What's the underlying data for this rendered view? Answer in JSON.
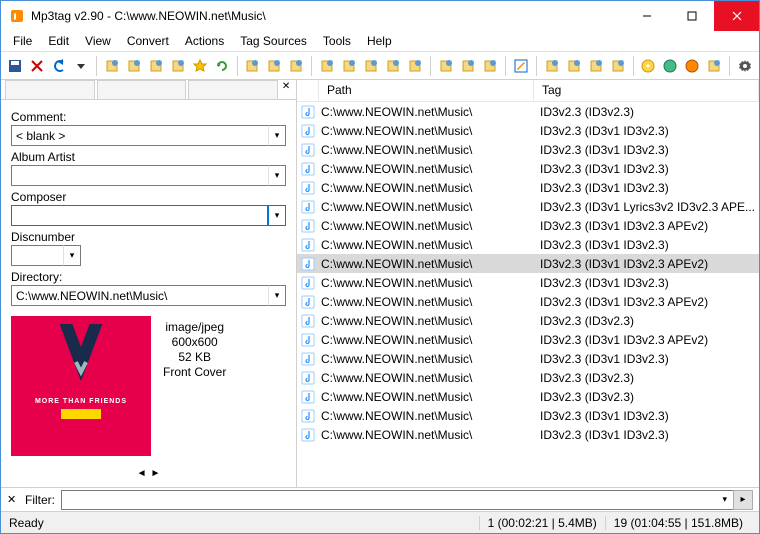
{
  "window": {
    "title": "Mp3tag v2.90  -  C:\\www.NEOWIN.net\\Music\\"
  },
  "menu": [
    "File",
    "Edit",
    "View",
    "Convert",
    "Actions",
    "Tag Sources",
    "Tools",
    "Help"
  ],
  "toolbar_icons": [
    "save-icon",
    "delete-icon",
    "undo-icon",
    "dropdown-icon",
    "open-folder-icon",
    "add-folder-icon",
    "save-playlist-icon",
    "save-all-icon",
    "favorites-icon",
    "refresh-icon",
    "list-icon",
    "list-numbered-icon",
    "highlight-icon",
    "tag-filename-icon",
    "filename-tag-icon",
    "tag-to-tag-icon",
    "text-to-tag-icon",
    "tag-to-text-icon",
    "actions-icon",
    "case-icon",
    "dropdown-small-icon",
    "edit-icon",
    "cut-tag-icon",
    "copy-tag-icon",
    "paste-tag-icon",
    "remove-tag-icon",
    "disc-icon",
    "web-icon",
    "cover-icon",
    "dropdown-small2-icon",
    "settings-icon"
  ],
  "panel": {
    "comment_label": "Comment:",
    "comment_value": "< blank >",
    "albumartist_label": "Album Artist",
    "albumartist_value": "",
    "composer_label": "Composer",
    "composer_value": "",
    "discnumber_label": "Discnumber",
    "discnumber_value": "",
    "directory_label": "Directory:",
    "directory_value": "C:\\www.NEOWIN.net\\Music\\",
    "cover": {
      "mime": "image/jpeg",
      "dims": "600x600",
      "size": "52 KB",
      "type": "Front Cover",
      "album_text": "MORE THAN FRIENDS"
    }
  },
  "columns": {
    "path": "Path",
    "tag": "Tag"
  },
  "rows": [
    {
      "path": "C:\\www.NEOWIN.net\\Music\\",
      "tag": "ID3v2.3 (ID3v2.3)"
    },
    {
      "path": "C:\\www.NEOWIN.net\\Music\\",
      "tag": "ID3v2.3 (ID3v1 ID3v2.3)"
    },
    {
      "path": "C:\\www.NEOWIN.net\\Music\\",
      "tag": "ID3v2.3 (ID3v1 ID3v2.3)"
    },
    {
      "path": "C:\\www.NEOWIN.net\\Music\\",
      "tag": "ID3v2.3 (ID3v1 ID3v2.3)"
    },
    {
      "path": "C:\\www.NEOWIN.net\\Music\\",
      "tag": "ID3v2.3 (ID3v1 ID3v2.3)"
    },
    {
      "path": "C:\\www.NEOWIN.net\\Music\\",
      "tag": "ID3v2.3 (ID3v1 Lyrics3v2 ID3v2.3 APE..."
    },
    {
      "path": "C:\\www.NEOWIN.net\\Music\\",
      "tag": "ID3v2.3 (ID3v1 ID3v2.3 APEv2)"
    },
    {
      "path": "C:\\www.NEOWIN.net\\Music\\",
      "tag": "ID3v2.3 (ID3v1 ID3v2.3)"
    },
    {
      "path": "C:\\www.NEOWIN.net\\Music\\",
      "tag": "ID3v2.3 (ID3v1 ID3v2.3 APEv2)",
      "selected": true
    },
    {
      "path": "C:\\www.NEOWIN.net\\Music\\",
      "tag": "ID3v2.3 (ID3v1 ID3v2.3)"
    },
    {
      "path": "C:\\www.NEOWIN.net\\Music\\",
      "tag": "ID3v2.3 (ID3v1 ID3v2.3 APEv2)"
    },
    {
      "path": "C:\\www.NEOWIN.net\\Music\\",
      "tag": "ID3v2.3 (ID3v2.3)"
    },
    {
      "path": "C:\\www.NEOWIN.net\\Music\\",
      "tag": "ID3v2.3 (ID3v1 ID3v2.3 APEv2)"
    },
    {
      "path": "C:\\www.NEOWIN.net\\Music\\",
      "tag": "ID3v2.3 (ID3v1 ID3v2.3)"
    },
    {
      "path": "C:\\www.NEOWIN.net\\Music\\",
      "tag": "ID3v2.3 (ID3v2.3)"
    },
    {
      "path": "C:\\www.NEOWIN.net\\Music\\",
      "tag": "ID3v2.3 (ID3v2.3)"
    },
    {
      "path": "C:\\www.NEOWIN.net\\Music\\",
      "tag": "ID3v2.3 (ID3v1 ID3v2.3)"
    },
    {
      "path": "C:\\www.NEOWIN.net\\Music\\",
      "tag": "ID3v2.3 (ID3v1 ID3v2.3)"
    }
  ],
  "filter": {
    "label": "Filter:",
    "value": ""
  },
  "status": {
    "ready": "Ready",
    "selection": "1 (00:02:21 | 5.4MB)",
    "total": "19 (01:04:55 | 151.8MB)"
  }
}
